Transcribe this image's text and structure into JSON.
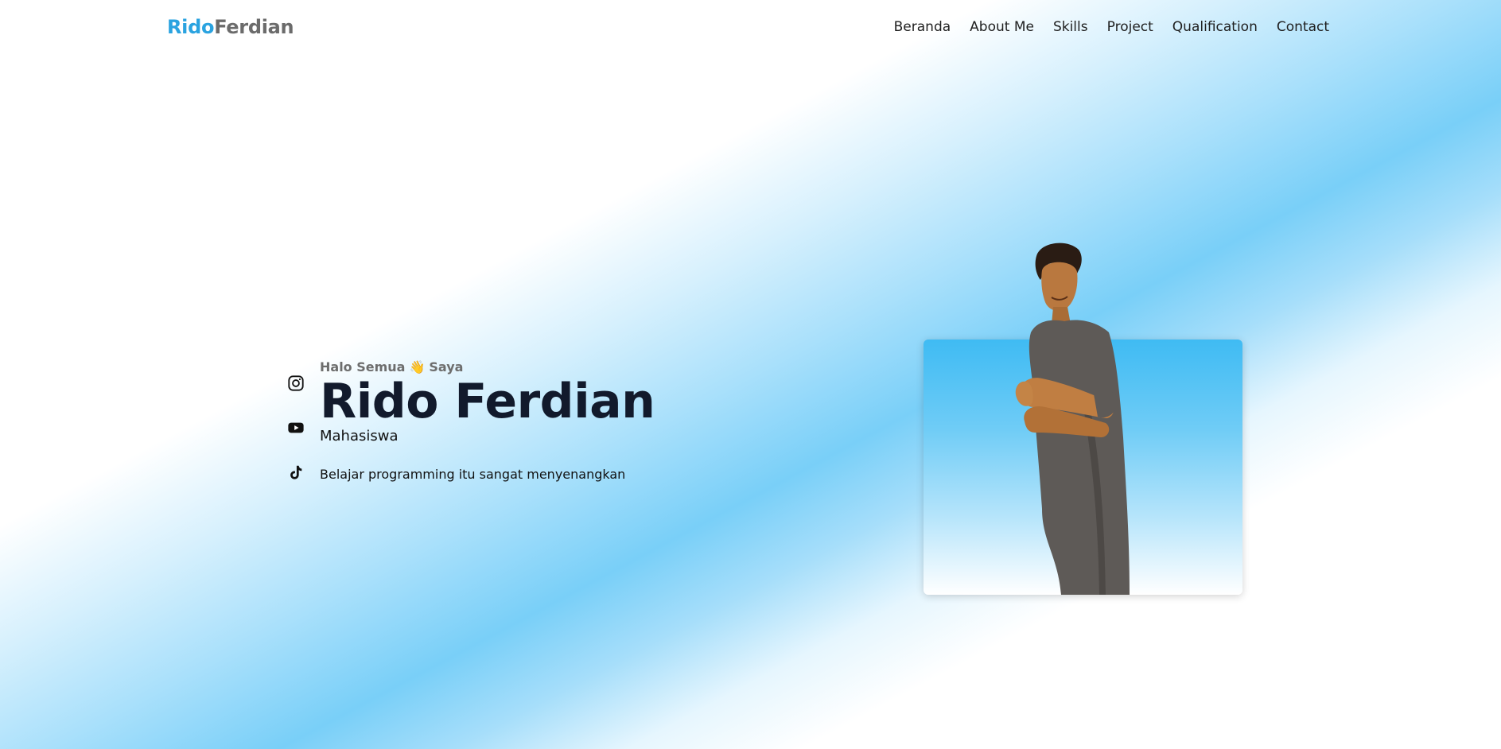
{
  "header": {
    "logo_first": "Rido",
    "logo_last": "Ferdian",
    "nav": [
      "Beranda",
      "About Me",
      "Skills",
      "Project",
      "Qualification",
      "Contact"
    ]
  },
  "social": [
    {
      "name": "instagram-icon"
    },
    {
      "name": "youtube-icon"
    },
    {
      "name": "tiktok-icon"
    }
  ],
  "hero": {
    "greeting_before": "Halo Semua",
    "greeting_emoji": "👋",
    "greeting_after": "Saya",
    "name": "Rido Ferdian",
    "role": "Mahasiswa",
    "tagline": "Belajar programming itu sangat menyenangkan"
  },
  "colors": {
    "accent": "#2aa3e0",
    "logo_gray": "#6b6b6b",
    "name_dark": "#121a2c",
    "photo_bg": "#3fbbf3"
  }
}
